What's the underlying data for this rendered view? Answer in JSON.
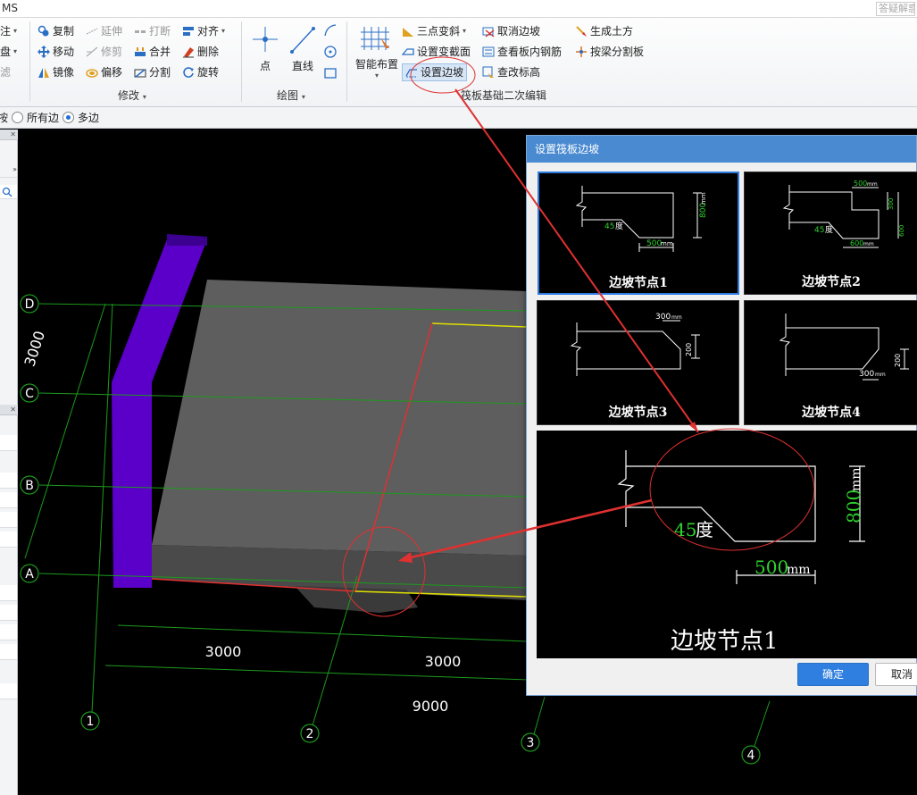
{
  "titlebar": {
    "app_name": "MS",
    "search_placeholder": "答疑解惑"
  },
  "ribbon": {
    "left_partial": {
      "item1": "注",
      "item2": "盘",
      "item3": "滤"
    },
    "modify": {
      "copy": "复制",
      "extend": "延伸",
      "break": "打断",
      "align": "对齐",
      "move": "移动",
      "trim": "修剪",
      "merge": "合并",
      "delete": "删除",
      "mirror": "镜像",
      "offset": "偏移",
      "split": "分割",
      "rotate": "旋转",
      "group_label": "修改"
    },
    "draw": {
      "point": "点",
      "line": "直线",
      "group_label": "绘图"
    },
    "raft": {
      "smart_layout": "智能布置",
      "three_point_slope": "三点变斜",
      "set_section": "设置变截面",
      "set_slope_edge": "设置边坡",
      "cancel_slope_edge": "取消边坡",
      "view_rebar": "查看板内钢筋",
      "edit_elevation": "查改标高",
      "gen_earthwork": "生成土方",
      "split_by_beam": "按梁分割板",
      "group_label": "筏板基础二次编辑"
    }
  },
  "optbar": {
    "partial_label": "按",
    "all_edges": "所有边",
    "multi_edge": "多边"
  },
  "viewport": {
    "axes_rows": [
      "D",
      "C",
      "B",
      "A"
    ],
    "axes_cols": [
      "1",
      "2",
      "3",
      "4"
    ],
    "dim_left": "3000",
    "dim_bottom_1": "3000",
    "dim_bottom_2": "3000",
    "dim_total": "9000"
  },
  "dialog": {
    "title": "设置筏板边坡",
    "nodes": [
      {
        "label": "边坡节点1",
        "angle": "45",
        "angle_unit": "度",
        "width": "500",
        "height": "800",
        "unit": "mm"
      },
      {
        "label": "边坡节点2",
        "angle": "45",
        "angle_unit": "度",
        "top_width": "500",
        "width": "600",
        "height": "600",
        "step_height": "300",
        "unit": "mm"
      },
      {
        "label": "边坡节点3",
        "width": "300",
        "height": "200",
        "unit": "mm"
      },
      {
        "label": "边坡节点4",
        "width": "300",
        "height": "200",
        "unit": "mm"
      }
    ],
    "preview": {
      "label": "边坡节点1",
      "angle": "45",
      "angle_unit": "度",
      "width": "500",
      "height": "800",
      "unit": "mm"
    },
    "ok_label": "确定",
    "cancel_label": "取消"
  },
  "colors": {
    "accent": "#2f7fe0",
    "dim_green": "#00c000",
    "annot_red": "#e03030",
    "column_purple": "#5a00c8"
  }
}
